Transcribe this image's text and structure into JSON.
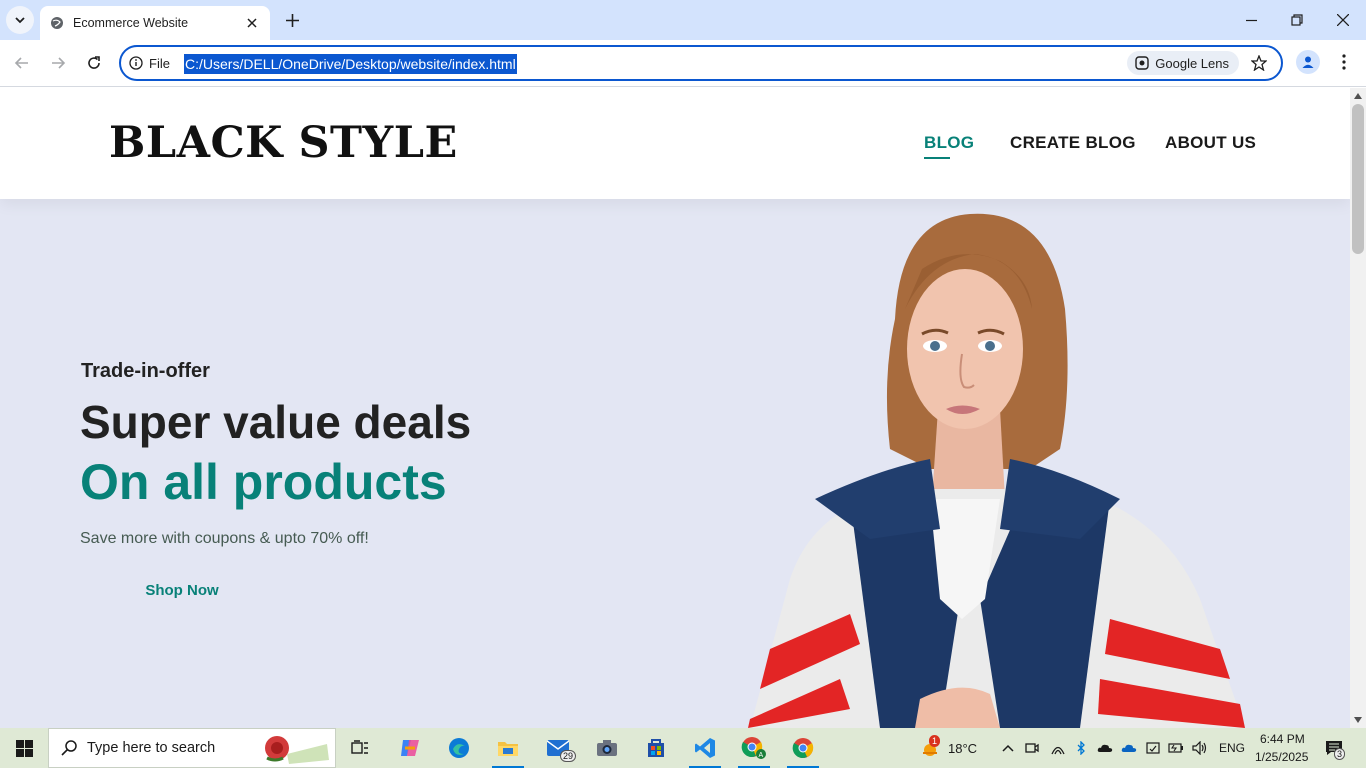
{
  "browser": {
    "tab_title": "Ecommerce Website",
    "site_info_label": "File",
    "url": "C:/Users/DELL/OneDrive/Desktop/website/index.html",
    "lens_label": "Google Lens"
  },
  "site": {
    "logo": "BLACK STYLE",
    "nav": [
      "BLOG",
      "CREATE BLOG",
      "ABOUT US"
    ],
    "active_nav": "BLOG"
  },
  "hero": {
    "subtitle": "Trade-in-offer",
    "headline": "Super value deals",
    "highlight": "On all products",
    "description": "Save more with coupons & upto 70% off!",
    "cta": "Shop Now"
  },
  "taskbar": {
    "search_placeholder": "Type here to search",
    "mail_badge": "29",
    "weather_temp": "18°C",
    "language": "ENG",
    "time": "6:44 PM",
    "date": "1/25/2025",
    "notification_count": "3",
    "weather_alert": "1"
  },
  "colors": {
    "accent": "#088178",
    "chrome_focus": "#0b57d0",
    "hero_bg": "#e3e6f3",
    "tabbar_bg": "#d3e3fd",
    "taskbar_bg": "#dfe9d5"
  }
}
